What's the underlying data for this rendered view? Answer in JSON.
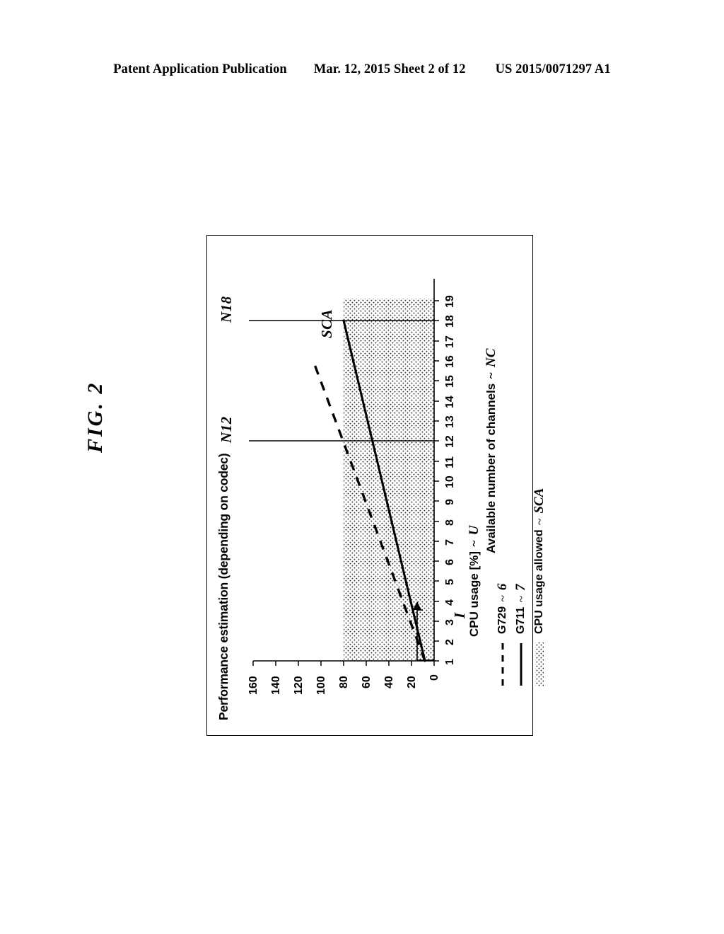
{
  "header": {
    "publication": "Patent Application Publication",
    "date_sheet": "Mar. 12, 2015  Sheet 2 of 12",
    "patent_number": "US 2015/0071297 A1"
  },
  "figure": {
    "label": "FIG. 2"
  },
  "chart_data": {
    "type": "line",
    "title": "Performance estimation (depending on codec)",
    "xlabel": "Available number of channels",
    "xlabel_ref": "NC",
    "ylabel": "CPU usage [%]",
    "ylabel_ref": "U",
    "xlim": [
      0,
      19.6
    ],
    "ylim": [
      0,
      165
    ],
    "xticks": [
      "1",
      "2",
      "3",
      "4",
      "5",
      "6",
      "7",
      "8",
      "9",
      "10",
      "11",
      "12",
      "13",
      "14",
      "15",
      "16",
      "17",
      "18",
      "19"
    ],
    "yticks": [
      "0",
      "20",
      "40",
      "60",
      "80",
      "100",
      "120",
      "140",
      "160"
    ],
    "grid": false,
    "legend_position": "below-left",
    "series": [
      {
        "name": "G729",
        "ref": "6",
        "style": "dashed",
        "x": [
          1,
          12,
          16
        ],
        "values": [
          8,
          80,
          107
        ]
      },
      {
        "name": "G711",
        "ref": "7",
        "style": "solid",
        "x": [
          1,
          18
        ],
        "values": [
          8,
          80
        ]
      },
      {
        "name": "CPU usage allowed",
        "ref": "SCA",
        "style": "dotted-fill",
        "x": [
          1,
          19
        ],
        "values": [
          80,
          80
        ]
      }
    ],
    "threshold": {
      "label": "SCA",
      "value": 80
    },
    "annotations": [
      {
        "name": "N12",
        "text": "N12",
        "x": 12,
        "note": "vertical marker at 12 channels where G729 reaches the allowed CPU usage"
      },
      {
        "name": "N18",
        "text": "N18",
        "x": 18,
        "note": "vertical marker at 18 channels where G711 reaches the allowed CPU usage"
      },
      {
        "name": "I",
        "text": "I",
        "x": 3.5,
        "note": "increment arrow near 3-4 channels"
      }
    ]
  },
  "legend": {
    "items": [
      {
        "label": "G729",
        "ref": "6",
        "style": "dashed"
      },
      {
        "label": "G711",
        "ref": "7",
        "style": "solid"
      },
      {
        "label": "CPU usage allowed",
        "ref": "SCA",
        "style": "dotted"
      }
    ]
  }
}
